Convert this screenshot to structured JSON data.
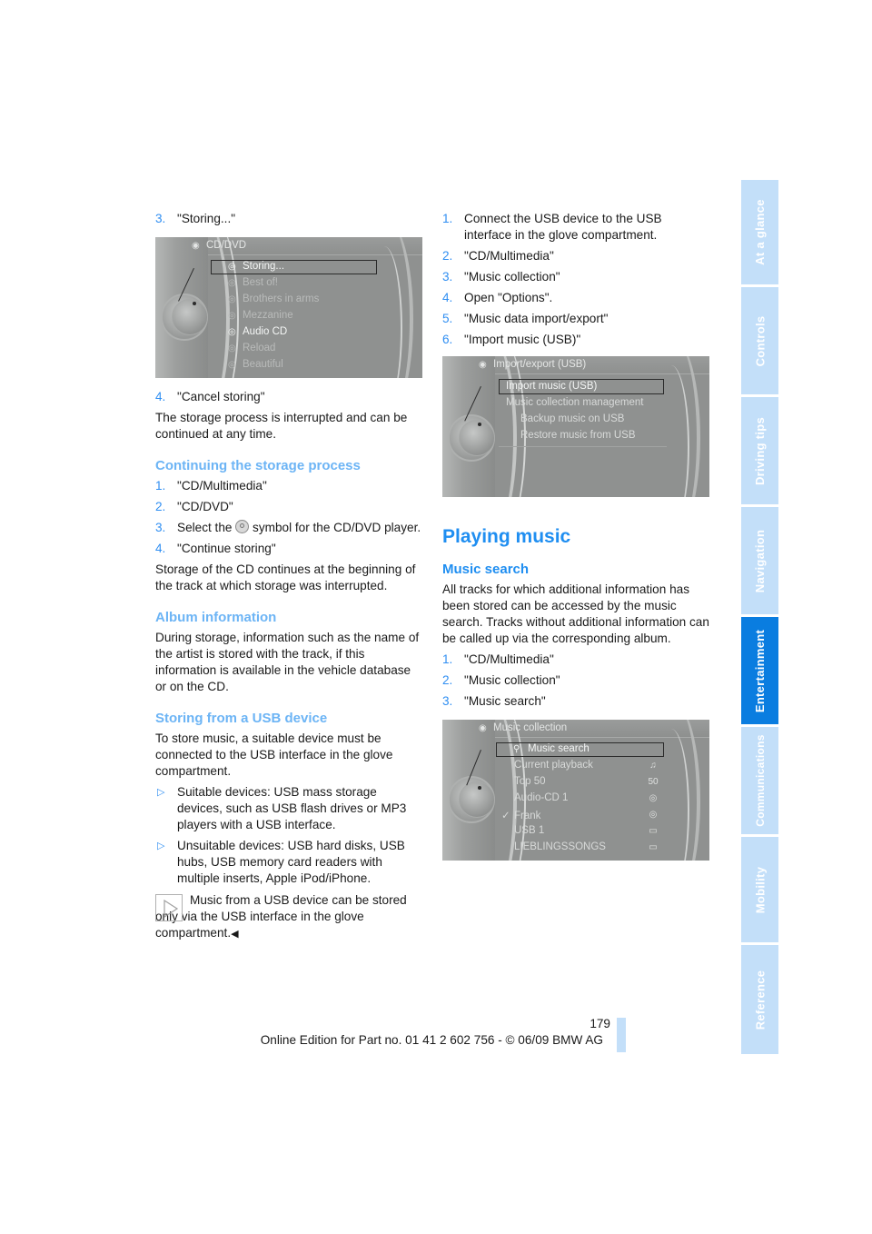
{
  "page_number": "179",
  "footer": "Online Edition for Part no. 01 41 2 602 756 - © 06/09 BMW AG",
  "side_tabs": [
    {
      "label": "At a glance",
      "active": false
    },
    {
      "label": "Controls",
      "active": false
    },
    {
      "label": "Driving tips",
      "active": false
    },
    {
      "label": "Navigation",
      "active": false
    },
    {
      "label": "Entertainment",
      "active": true
    },
    {
      "label": "Communications",
      "active": false
    },
    {
      "label": "Mobility",
      "active": false
    },
    {
      "label": "Reference",
      "active": false
    }
  ],
  "left": {
    "step3": {
      "num": "3.",
      "text": "\"Storing...\""
    },
    "screen1": {
      "title": "CD/DVD",
      "items": [
        "Storing...",
        "Best of!",
        "Brothers in arms",
        "Mezzanine",
        "Audio CD",
        "Reload",
        "Beautiful"
      ]
    },
    "step4": {
      "num": "4.",
      "text": "\"Cancel storing\""
    },
    "cancel_para": "The storage process is interrupted and can be continued at any time.",
    "continuing": {
      "heading": "Continuing the storage process",
      "steps": [
        {
          "num": "1.",
          "text": "\"CD/Multimedia\""
        },
        {
          "num": "2.",
          "text": "\"CD/DVD\""
        },
        {
          "num": "3.",
          "text_before": "Select the",
          "text_after": "symbol for the CD/DVD player."
        },
        {
          "num": "4.",
          "text": "\"Continue storing\""
        }
      ],
      "para": "Storage of the CD continues at the beginning of the track at which storage was interrupted."
    },
    "album": {
      "heading": "Album information",
      "para": "During storage, information such as the name of the artist is stored with the track, if this information is available in the vehicle database or on the CD."
    },
    "usb": {
      "heading": "Storing from a USB device",
      "para": "To store music, a suitable device must be connected to the USB interface in the glove compartment.",
      "bullets": [
        "Suitable devices: USB mass storage devices, such as USB flash drives or MP3 players with a USB interface.",
        "Unsuitable devices: USB hard disks, USB hubs, USB memory card readers with multiple inserts, Apple iPod/iPhone."
      ],
      "note": "Music from a USB device can be stored only via the USB interface in the glove compartment."
    }
  },
  "right": {
    "steps": [
      {
        "num": "1.",
        "text": "Connect the USB device to the USB interface in the glove compartment."
      },
      {
        "num": "2.",
        "text": "\"CD/Multimedia\""
      },
      {
        "num": "3.",
        "text": "\"Music collection\""
      },
      {
        "num": "4.",
        "text": "Open \"Options\"."
      },
      {
        "num": "5.",
        "text": "\"Music data import/export\""
      },
      {
        "num": "6.",
        "text": "\"Import music (USB)\""
      }
    ],
    "screen2": {
      "title": "Import/export (USB)",
      "items": [
        "Import music (USB)",
        "Music collection management",
        "Backup music on USB",
        "Restore music from USB"
      ]
    },
    "playing": {
      "heading": "Playing music",
      "subheading": "Music search",
      "para": "All tracks for which additional information has been stored can be accessed by the music search. Tracks without additional information can be called up via the corresponding album.",
      "steps": [
        {
          "num": "1.",
          "text": "\"CD/Multimedia\""
        },
        {
          "num": "2.",
          "text": "\"Music collection\""
        },
        {
          "num": "3.",
          "text": "\"Music search\""
        }
      ]
    },
    "screen3": {
      "title": "Music collection",
      "items": [
        {
          "label": "Music search",
          "right": ""
        },
        {
          "label": "Current playback",
          "right": "♫"
        },
        {
          "label": "Top 50",
          "right": "50"
        },
        {
          "label": "Audio-CD 1",
          "right": "◎"
        },
        {
          "label": "Frank",
          "right": "◎",
          "checked": true
        },
        {
          "label": "USB 1",
          "right": "▭"
        },
        {
          "label": "LIEBLINGSSONGS",
          "right": "▭"
        }
      ]
    }
  },
  "colors": {
    "accent": "#1f8ef1",
    "subheading": "#6cb4f5",
    "tab": "#c3dff9",
    "tab_active": "#0a7de0"
  }
}
